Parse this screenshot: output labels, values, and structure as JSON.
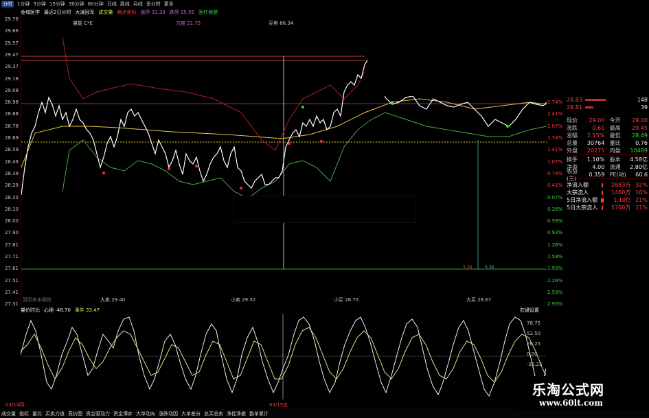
{
  "period_tabs": [
    "分时",
    "1分钟",
    "5分钟",
    "15分钟",
    "30分钟",
    "60分钟",
    "日线",
    "周线",
    "月线",
    "多分时",
    "更多"
  ],
  "active_tab_index": 0,
  "info": {
    "stock": "金域医学",
    "range": "最近2日分时",
    "crowd": "大通冠军",
    "vol": "成交量",
    "twopoint": "两点坐标",
    "rise_label": "涨停 31.23",
    "fall_label": "跌停 25.55",
    "sector": "医疗保健"
  },
  "chart_labels": {
    "liangneng": "量能 C*E",
    "liduan": "力度 21.75",
    "maimai": "买卖 66.34",
    "dasell": "大卖 29.40",
    "xiaosell": "小卖 29.32",
    "xiaobuy": "小买 28.75",
    "dabuy": "大买 28.67",
    "bottom_note": "暂明来未跟踪",
    "v1": "5.34",
    "v2": "5.34"
  },
  "y_left": [
    "29.76",
    "29.66",
    "29.57",
    "29.47",
    "29.37",
    "29.18",
    "29.08",
    "28.98",
    "28.88",
    "28.78",
    "28.69",
    "28.59",
    "28.49",
    "28.39",
    "28.29",
    "28.20",
    "28.10",
    "28.00",
    "27.90",
    "27.81",
    "27.71",
    "27.61",
    "27.51",
    "27.41",
    "27.31"
  ],
  "y_right": [
    "5.07%",
    "4.73%",
    "4.40%",
    "4.07%",
    "3.74%",
    "3.40%",
    "3.07%",
    "2.74%",
    "2.41%",
    "2.07%",
    "1.74%",
    "1.41%",
    "1.07%",
    "0.74%",
    "0.41%",
    "0.07%",
    "0.26%",
    "0.59%",
    "0.93%",
    "1.26%",
    "1.59%",
    "1.93%",
    "2.26%",
    "2.59%",
    "2.93%"
  ],
  "quote": {
    "ask_rows": [
      [
        "28.83",
        "148"
      ],
      [
        "28.81",
        "39"
      ]
    ],
    "rows": [
      [
        "现价",
        "29.00",
        "今开",
        "29.00"
      ],
      [
        "涨跌",
        "0.61",
        "最高",
        "29.45"
      ],
      [
        "涨幅",
        "2.15%",
        "最低",
        "28.49"
      ],
      [
        "总量",
        "30764",
        "量比",
        "0.76"
      ],
      [
        "外盘",
        "20275",
        "内盘",
        "10489"
      ],
      [
        "换手",
        "1.10%",
        "股本",
        "4.58亿"
      ],
      [
        "净资",
        "4.00",
        "流通",
        "2.80亿"
      ],
      [
        "收益(三)",
        "0.359",
        "PE(动)",
        "60.6"
      ]
    ],
    "flow_rows": [
      [
        "净流入额",
        "2883万",
        "32%"
      ],
      [
        "大宗流入",
        "1460万",
        "16%"
      ],
      [
        "5日净流入额",
        "1.10亿",
        "21%"
      ],
      [
        "5日大宗流入",
        "5760万",
        "21%"
      ]
    ]
  },
  "indicator": {
    "name": "量价时比",
    "line1": "心理 -48.70",
    "line2": "事件 33.47",
    "settings": "右键设置",
    "ticks": [
      "78.75",
      "52.50",
      "26.25",
      "0.00",
      "-26.25"
    ]
  },
  "dates": [
    "03/14四",
    "03/15五"
  ],
  "bottom_tabs": [
    "成交量",
    "指标",
    "量比",
    "买卖力道",
    "竞价图",
    "资金驱动力",
    "资金博弈",
    "大单动向",
    "涨跌动因",
    "大单差分",
    "总买总卖",
    "净挂净撤",
    "勤单累计"
  ],
  "watermark": {
    "title": "乐淘公式网",
    "url": "www.60lt.com"
  },
  "colors": {
    "up": "#ff4040",
    "down": "#33dd33",
    "price_line": "#ffffff",
    "avg_line": "#e6c84a",
    "bg": "#000000"
  }
}
